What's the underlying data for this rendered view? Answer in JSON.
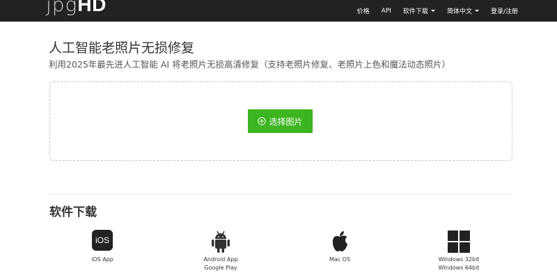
{
  "brand": {
    "logo_left": "jpg",
    "logo_right": "HD"
  },
  "nav": {
    "items": [
      {
        "label": "价格"
      },
      {
        "label": "API"
      },
      {
        "label": "软件下载"
      },
      {
        "label": "简体中文"
      },
      {
        "label": "登录/注册"
      }
    ]
  },
  "hero": {
    "title": "人工智能老照片无损修复",
    "subtitle": "利用2025年最先进人工智能 AI 将老照片无损高清修复（支持老照片修复、老照片上色和魔法动态照片）",
    "button_label": "选择图片"
  },
  "downloads": {
    "title": "软件下载",
    "items": [
      {
        "icon": "ios-icon",
        "icon_text": "iOS",
        "label1": "iOS App",
        "label2": ""
      },
      {
        "icon": "android-icon",
        "label1": "Android App",
        "label2": "Google Play"
      },
      {
        "icon": "apple-icon",
        "label1": "Mac OS",
        "label2": ""
      },
      {
        "icon": "windows-icon",
        "label1": "Windows 32bit",
        "label2": "Windows 64bit"
      }
    ]
  },
  "colors": {
    "navbar": "#222222",
    "accent_green": "#3cb521"
  }
}
